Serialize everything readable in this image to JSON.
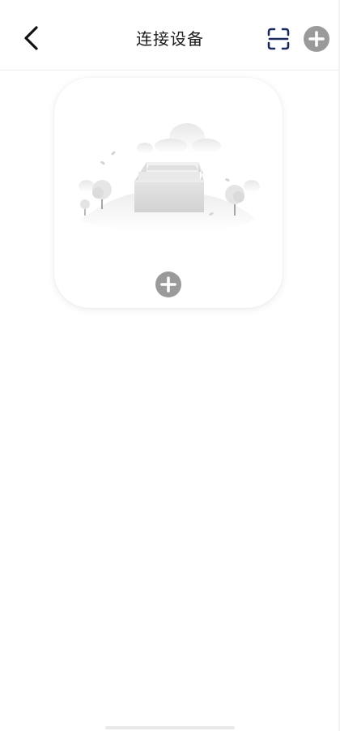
{
  "header": {
    "title": "连接设备",
    "back_icon": "chevron-left-icon",
    "scan_icon": "scan-icon",
    "add_icon": "plus-circle-icon"
  },
  "device_card": {
    "illustration": "empty-box-illustration",
    "add_icon": "plus-circle-icon"
  },
  "colors": {
    "title": "#1b1b1b",
    "scan_icon": "#1b2a5e",
    "add_icon_fill": "#9a9a9a",
    "background": "#ffffff"
  }
}
